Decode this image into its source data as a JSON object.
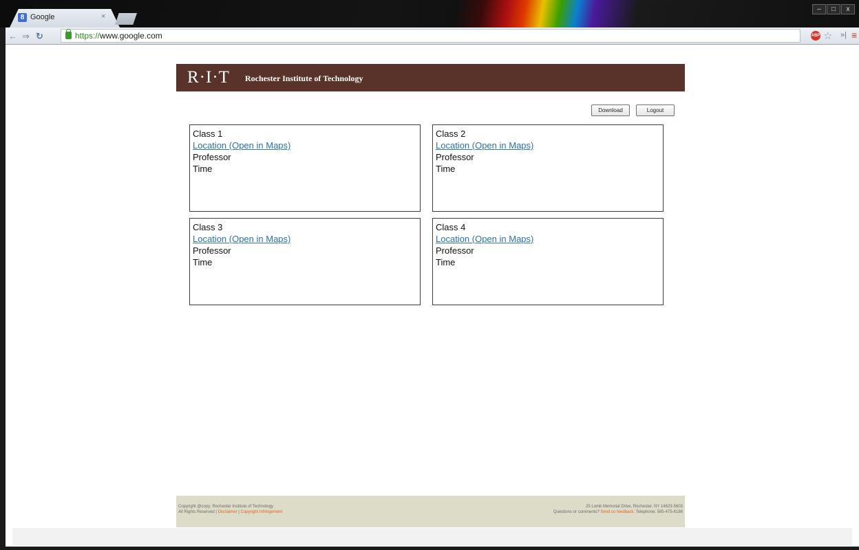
{
  "browser": {
    "tab_title": "Google",
    "tab_favicon": "8",
    "tab_close": "×",
    "url_scheme": "https://",
    "url_host": "www.google.com",
    "window_controls": [
      "–",
      "□",
      "x"
    ],
    "adblock_label": "ABP"
  },
  "header": {
    "logo": "R·I·T",
    "institute_name": "Rochester Institute of Technology",
    "background_color": "#59332a"
  },
  "actions": {
    "download_label": "Download",
    "logout_label": "Logout"
  },
  "classes": [
    {
      "name": "Class 1",
      "location_link": "Location (Open in Maps)",
      "professor": "Professor",
      "time": "Time"
    },
    {
      "name": "Class 2",
      "location_link": "Location (Open in Maps)",
      "professor": "Professor",
      "time": "Time"
    },
    {
      "name": "Class 3",
      "location_link": "Location (Open in Maps)",
      "professor": "Professor",
      "time": "Time"
    },
    {
      "name": "Class 4",
      "location_link": "Location (Open in Maps)",
      "professor": "Professor",
      "time": "Time"
    }
  ],
  "footer": {
    "copyright": "Copyright @copy; Rochester Institute of Technology",
    "rights": "All Rights Reserved |",
    "disclaimer": "Disclaimer",
    "sep": "|",
    "copyright_infringement": "Copyright Infringement",
    "address": "25 Lomb Memorial Drive, Rochester, NY 14623-5603",
    "questions": "Questions or comments?",
    "feedback_link": "Send us feedback.",
    "telephone": "Telephone: 585-475-6186",
    "background_color": "#dddcc8",
    "link_color": "#e0622a"
  }
}
